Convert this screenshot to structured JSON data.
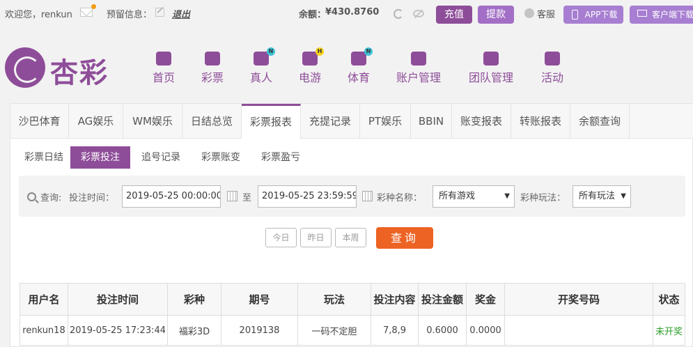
{
  "topbar": {
    "welcome": "欢迎您，renkun",
    "reserved_info_label": "预留信息：",
    "logout": "退出",
    "balance_label": "余额：",
    "balance_value": "¥430.8760",
    "recharge": "充值",
    "withdraw": "提款",
    "service": "客服",
    "app_download": "APP下载",
    "client_download": "客户端下载"
  },
  "brand": {
    "logo_text": "杏彩"
  },
  "nav": [
    {
      "label": "首页",
      "icon": "home-icon",
      "badge": ""
    },
    {
      "label": "彩票",
      "icon": "lottery-ticket-icon",
      "badge": ""
    },
    {
      "label": "真人",
      "icon": "live-dealer-icon",
      "badge": "N"
    },
    {
      "label": "电游",
      "icon": "gamepad-icon",
      "badge": "H"
    },
    {
      "label": "体育",
      "icon": "trophy-icon",
      "badge": "N"
    },
    {
      "label": "账户管理",
      "icon": "account-icon",
      "badge": ""
    },
    {
      "label": "团队管理",
      "icon": "team-icon",
      "badge": ""
    },
    {
      "label": "活动",
      "icon": "gift-icon",
      "badge": ""
    }
  ],
  "tabs": [
    "沙巴体育",
    "AG娱乐",
    "WM娱乐",
    "日结总览",
    "彩票报表",
    "充提记录",
    "PT娱乐",
    "BBIN",
    "账变报表",
    "转账报表",
    "余额查询"
  ],
  "active_tab": "彩票报表",
  "subtabs": [
    "彩票日结",
    "彩票投注",
    "追号记录",
    "彩票账变",
    "彩票盈亏"
  ],
  "active_subtab": "彩票投注",
  "filter": {
    "query_label": "查询:",
    "bet_time_label": "投注时间：",
    "start_time": "2019-05-25 00:00:00",
    "to_label": "至",
    "end_time": "2019-05-25 23:59:59",
    "game_label": "彩种名称：",
    "game_value": "所有游戏",
    "play_label": "彩种玩法：",
    "play_value": "所有玩法"
  },
  "quick": {
    "today": "今日",
    "yesterday": "昨日",
    "week": "本周",
    "search": "查询"
  },
  "table": {
    "headers": [
      "用户名",
      "投注时间",
      "彩种",
      "期号",
      "玩法",
      "投注内容",
      "投注金额",
      "奖金",
      "开奖号码",
      "状态"
    ],
    "rows": [
      [
        "renkun18",
        "2019-05-25 17:23:44",
        "福彩3D",
        "2019138",
        "一码不定胆",
        "7,8,9",
        "0.6000",
        "0.0000",
        "",
        "未开奖"
      ]
    ]
  },
  "colors": {
    "brand": "#8e4d99",
    "accent": "#ec6324",
    "status_pending": "#2a9d2a"
  }
}
